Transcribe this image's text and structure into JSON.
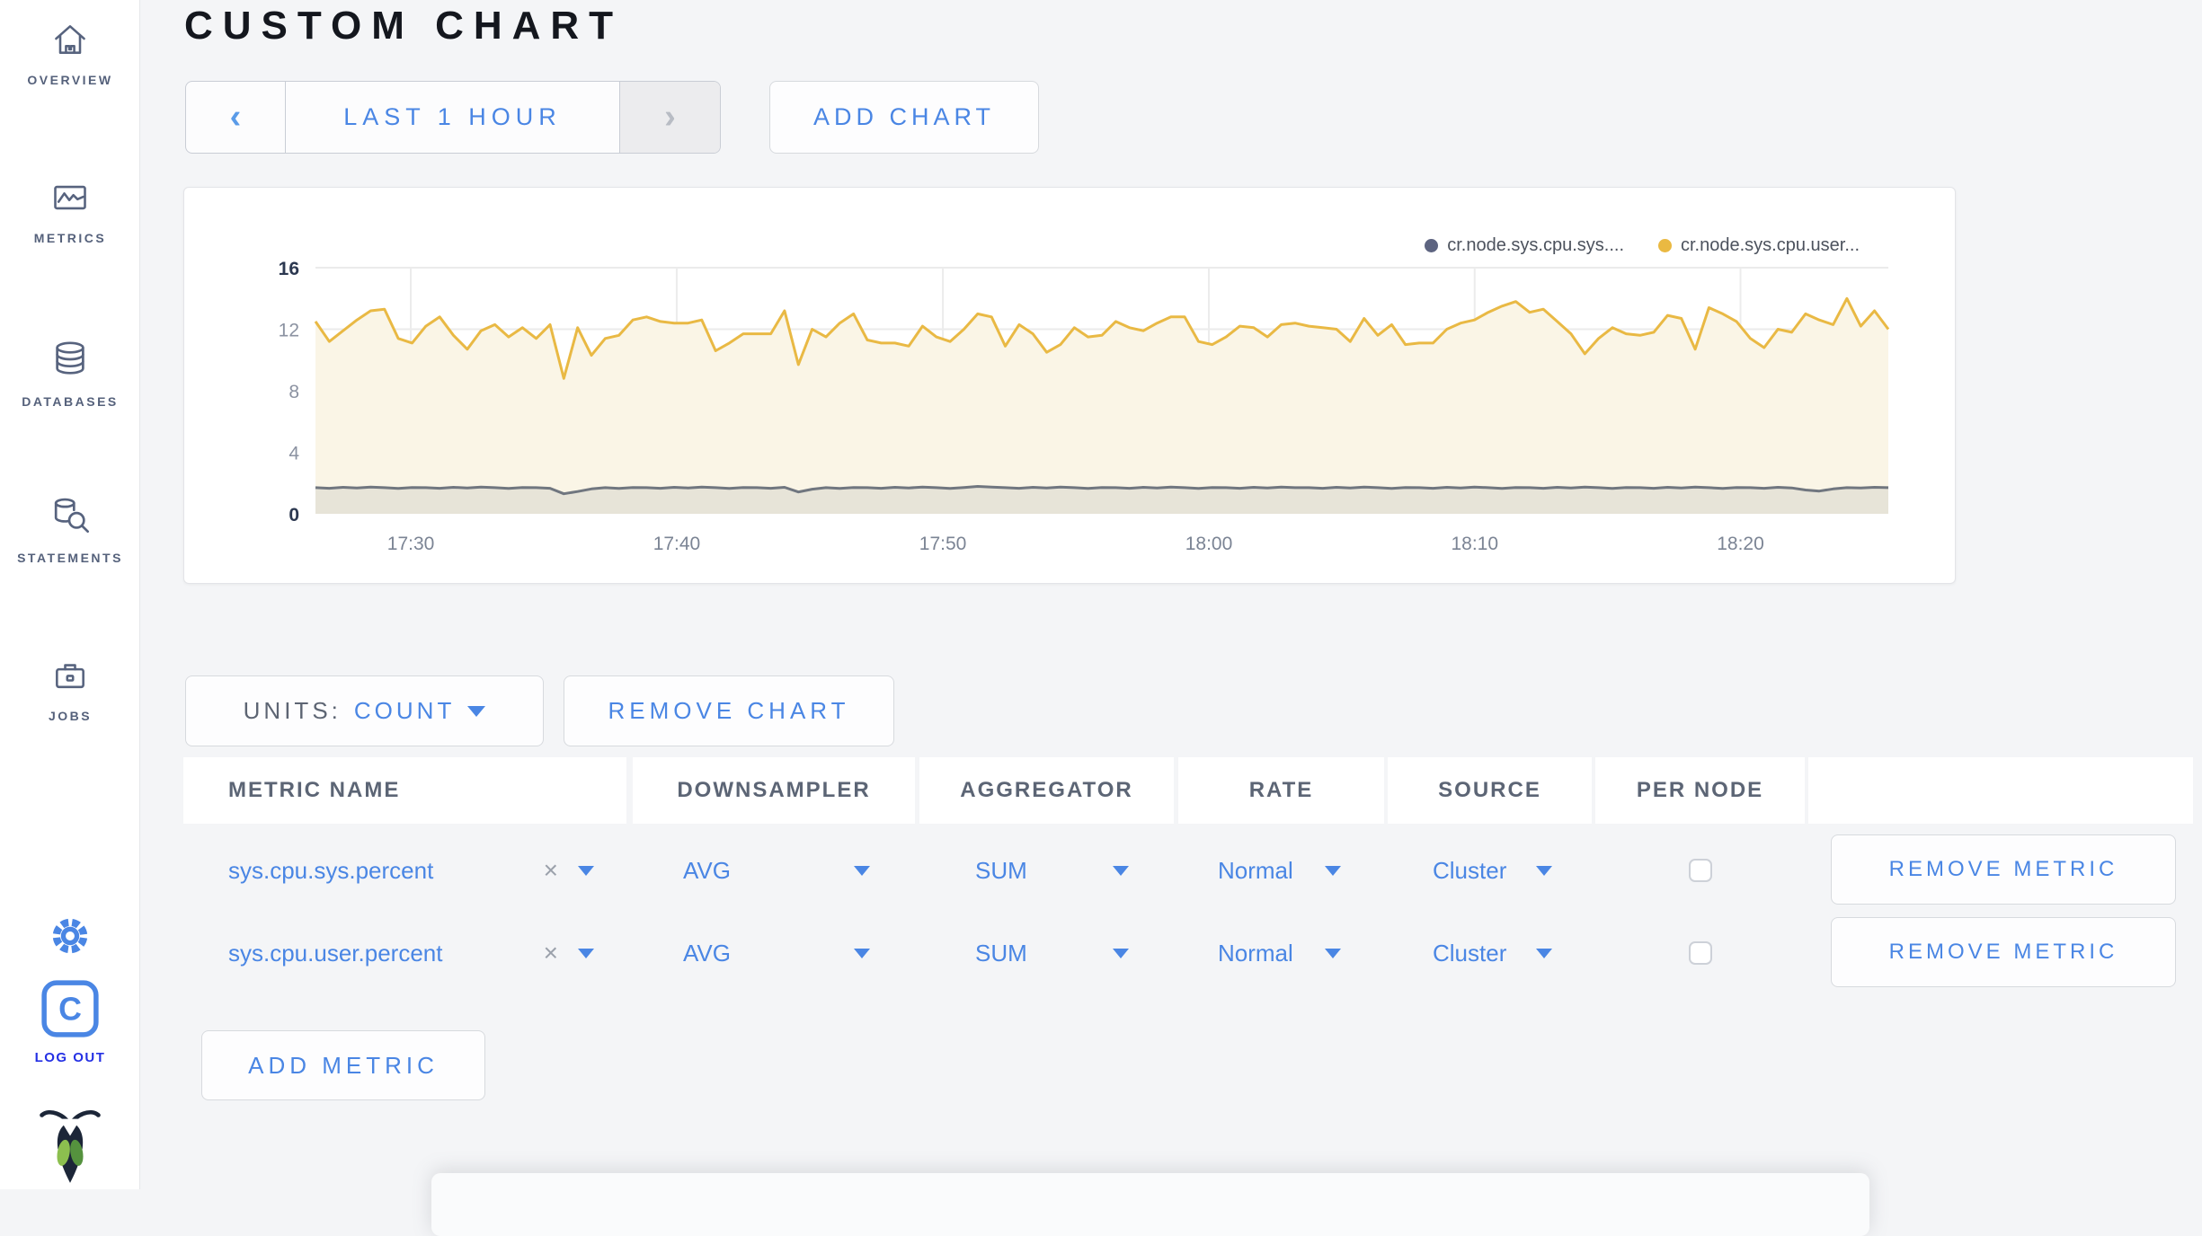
{
  "sidebar": {
    "items": [
      {
        "label": "OVERVIEW"
      },
      {
        "label": "METRICS"
      },
      {
        "label": "DATABASES"
      },
      {
        "label": "STATEMENTS"
      },
      {
        "label": "JOBS"
      }
    ],
    "logout_label": "LOG OUT",
    "logo_letter": "C"
  },
  "header": {
    "title": "CUSTOM CHART",
    "time_window": "LAST 1 HOUR",
    "time_prev_symbol": "‹",
    "time_next_symbol": "›",
    "add_chart_label": "ADD CHART"
  },
  "chart_controls": {
    "units_label": "UNITS:",
    "units_value": "COUNT",
    "remove_chart_label": "REMOVE CHART"
  },
  "metrics_table": {
    "columns": [
      "METRIC NAME",
      "DOWNSAMPLER",
      "AGGREGATOR",
      "RATE",
      "SOURCE",
      "PER NODE",
      ""
    ],
    "clear_symbol": "×",
    "rows": [
      {
        "metric": "sys.cpu.sys.percent",
        "downsampler": "AVG",
        "aggregator": "SUM",
        "rate": "Normal",
        "source": "Cluster",
        "per_node": false,
        "remove_label": "REMOVE METRIC"
      },
      {
        "metric": "sys.cpu.user.percent",
        "downsampler": "AVG",
        "aggregator": "SUM",
        "rate": "Normal",
        "source": "Cluster",
        "per_node": false,
        "remove_label": "REMOVE METRIC"
      }
    ],
    "add_metric_label": "ADD METRIC"
  },
  "chart_data": {
    "type": "line",
    "title": "",
    "xlabel": "",
    "ylabel": "",
    "ylim": [
      0,
      16
    ],
    "y_ticks": [
      0,
      4,
      8,
      12,
      16
    ],
    "x_ticks": [
      "17:30",
      "17:40",
      "17:50",
      "18:00",
      "18:10",
      "18:20"
    ],
    "x_tick_fracs": [
      0.0606,
      0.2297,
      0.3989,
      0.568,
      0.737,
      0.906
    ],
    "grid": true,
    "legend_position": "top-right",
    "series": [
      {
        "name": "cr.node.sys.cpu.sys....",
        "color": "#70767f",
        "legend_color": "#5d6480",
        "fill": "rgba(112,118,127,0.13)",
        "values": [
          1.7,
          1.66,
          1.72,
          1.68,
          1.74,
          1.7,
          1.65,
          1.71,
          1.7,
          1.66,
          1.72,
          1.68,
          1.74,
          1.7,
          1.65,
          1.71,
          1.7,
          1.66,
          1.3,
          1.45,
          1.62,
          1.7,
          1.65,
          1.71,
          1.7,
          1.66,
          1.72,
          1.68,
          1.74,
          1.7,
          1.65,
          1.71,
          1.7,
          1.66,
          1.72,
          1.42,
          1.6,
          1.7,
          1.65,
          1.71,
          1.7,
          1.66,
          1.72,
          1.68,
          1.74,
          1.7,
          1.65,
          1.71,
          1.78,
          1.74,
          1.7,
          1.66,
          1.72,
          1.68,
          1.74,
          1.7,
          1.65,
          1.71,
          1.7,
          1.66,
          1.72,
          1.68,
          1.74,
          1.7,
          1.65,
          1.71,
          1.7,
          1.66,
          1.72,
          1.68,
          1.74,
          1.7,
          1.7,
          1.66,
          1.72,
          1.68,
          1.74,
          1.7,
          1.65,
          1.71,
          1.7,
          1.66,
          1.72,
          1.68,
          1.74,
          1.7,
          1.65,
          1.71,
          1.7,
          1.66,
          1.72,
          1.68,
          1.74,
          1.7,
          1.65,
          1.71,
          1.7,
          1.66,
          1.72,
          1.68,
          1.74,
          1.7,
          1.65,
          1.71,
          1.7,
          1.66,
          1.72,
          1.68,
          1.55,
          1.48,
          1.62,
          1.7,
          1.68,
          1.72,
          1.7
        ]
      },
      {
        "name": "cr.node.sys.cpu.user...",
        "color": "#e9b944",
        "legend_color": "#eab942",
        "fill": "#faf5e6",
        "values": [
          12.5,
          11.2,
          11.9,
          12.6,
          13.2,
          13.3,
          11.4,
          11.1,
          12.2,
          12.8,
          11.6,
          10.7,
          11.9,
          12.3,
          11.5,
          12.1,
          11.4,
          12.3,
          8.8,
          12.1,
          10.3,
          11.4,
          11.6,
          12.6,
          12.8,
          12.5,
          12.4,
          12.4,
          12.6,
          10.6,
          11.1,
          11.7,
          11.7,
          11.7,
          13.2,
          9.7,
          12.0,
          11.5,
          12.4,
          13.0,
          11.3,
          11.1,
          11.1,
          10.9,
          12.2,
          11.5,
          11.2,
          12.0,
          13.0,
          12.8,
          10.9,
          12.3,
          11.7,
          10.5,
          11.0,
          12.1,
          11.5,
          11.6,
          12.5,
          12.1,
          11.9,
          12.4,
          12.8,
          12.8,
          11.2,
          11.0,
          11.5,
          12.2,
          12.1,
          11.5,
          12.3,
          12.4,
          12.2,
          12.1,
          12.0,
          11.2,
          12.7,
          11.6,
          12.3,
          11.0,
          11.1,
          11.1,
          12.0,
          12.4,
          12.6,
          13.1,
          13.5,
          13.8,
          13.1,
          13.3,
          12.5,
          11.7,
          10.4,
          11.4,
          12.1,
          11.7,
          11.6,
          11.8,
          12.9,
          12.7,
          10.7,
          13.4,
          13.0,
          12.5,
          11.4,
          10.8,
          12.0,
          11.8,
          13.0,
          12.6,
          12.3,
          14.0,
          12.2,
          13.2,
          12.0
        ]
      }
    ]
  }
}
